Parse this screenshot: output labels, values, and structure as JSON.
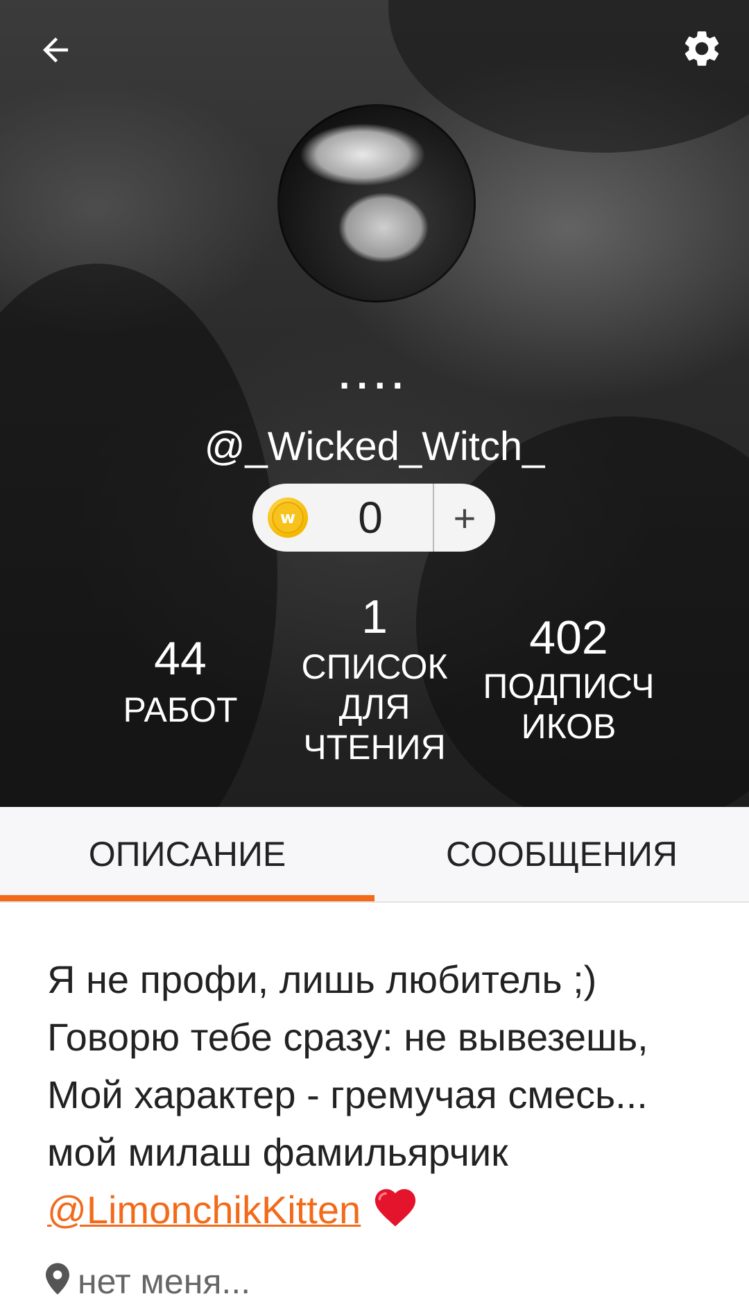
{
  "header": {
    "display_name": "....",
    "username": "@_Wicked_Witch_",
    "icons": {
      "back": "arrow-left-icon",
      "settings": "gear-icon",
      "coin": "wattpad-coin-icon"
    }
  },
  "coins": {
    "count": "0",
    "add_label": "+"
  },
  "stats": {
    "works": {
      "value": "44",
      "label": "РАБОТ"
    },
    "reading_lists": {
      "value": "1",
      "label_lines": [
        "СПИСОК",
        "ДЛЯ",
        "ЧТЕНИЯ"
      ]
    },
    "followers": {
      "value": "402",
      "label_lines": [
        "ПОДПИСЧ",
        "ИКОВ"
      ]
    }
  },
  "tabs": [
    {
      "label": "ОПИСАНИЕ",
      "active": true
    },
    {
      "label": "СООБЩЕНИЯ",
      "active": false
    }
  ],
  "about": {
    "lines": [
      "Я не профи, лишь любитель ;)",
      "Говорю тебе сразу: не вывезешь,",
      "Мой характер - гремучая смесь...",
      "мой милаш фамильярчик"
    ],
    "mention": "@LimonchikKitten",
    "emoji": "heart-icon",
    "location": "нет меня..."
  },
  "colors": {
    "accent": "#f26a1a",
    "tab_bg": "#f7f6f8",
    "header_bg": "#2b2b2b"
  }
}
